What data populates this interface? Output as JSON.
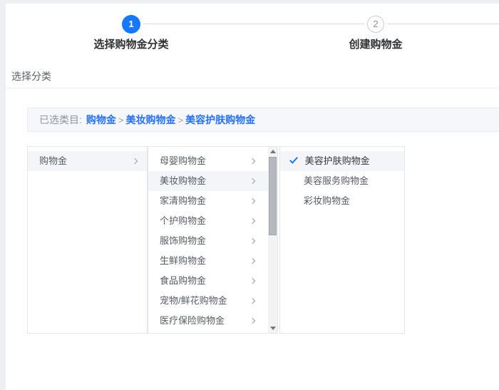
{
  "colors": {
    "accent_blue": "#1677ff",
    "link_blue": "#2470ff",
    "page_background": "#edeff3",
    "card_background": "#ffffff",
    "panel_background": "#f5f7fa",
    "selected_row_background": "#f3f5f8",
    "border": "#e3e6eb",
    "text_dark": "#303133",
    "text_gray": "#8f959e"
  },
  "stepper": {
    "steps": [
      {
        "number": "1",
        "label": "选择购物金分类",
        "state": "active"
      },
      {
        "number": "2",
        "label": "创建购物金",
        "state": "pending"
      }
    ]
  },
  "page": {
    "section_title": "选择分类"
  },
  "breadcrumb": {
    "label": "已选类目:",
    "separator": ">",
    "path": [
      "购物金",
      "美妆购物金",
      "美容护肤购物金"
    ]
  },
  "cascader": {
    "column1": {
      "items": [
        "购物金"
      ],
      "selected_index": 0
    },
    "column2": {
      "items": [
        "母婴购物金",
        "美妆购物金",
        "家清购物金",
        "个护购物金",
        "服饰购物金",
        "生鲜购物金",
        "食品购物金",
        "宠物/鲜花购物金",
        "医疗保险购物金"
      ],
      "selected_index": 1,
      "has_scrollbar": true
    },
    "column3": {
      "items": [
        "美容护肤购物金",
        "美容服务购物金",
        "彩妆购物金"
      ],
      "selected_index": 0,
      "checked_index": 0
    }
  }
}
